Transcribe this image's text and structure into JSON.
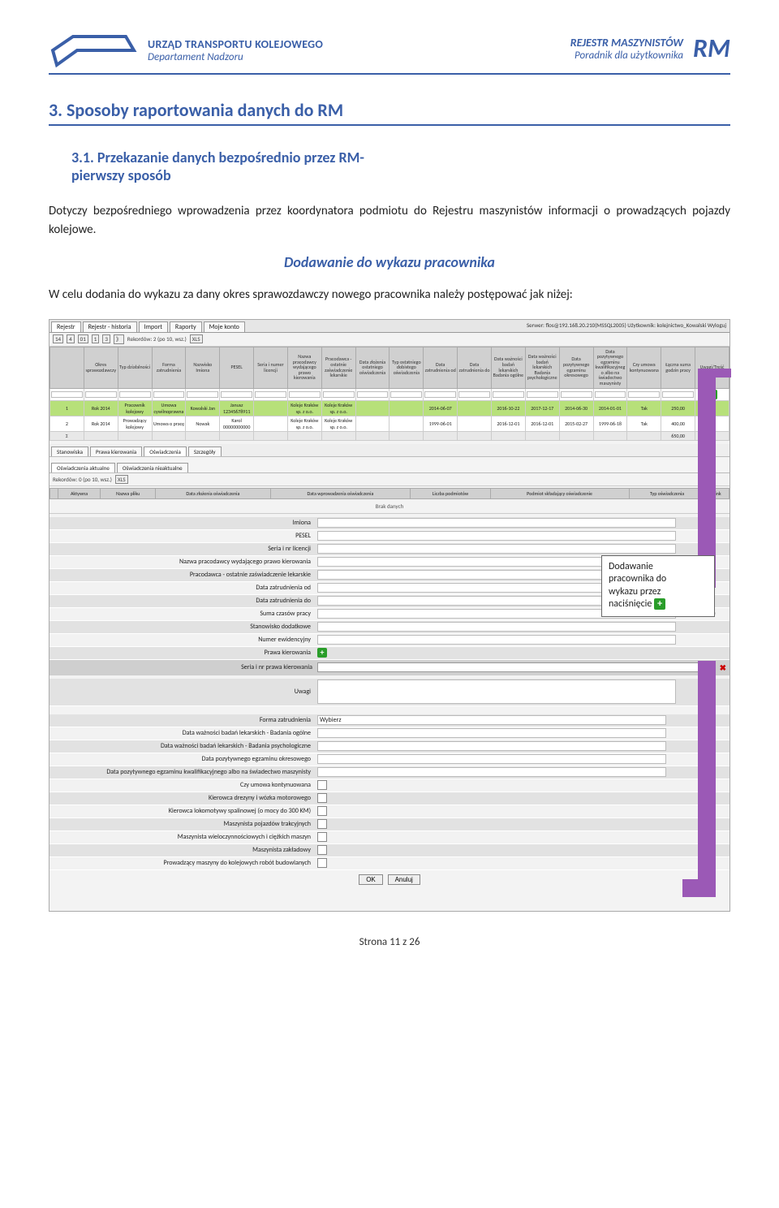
{
  "header": {
    "left_line1": "URZĄD TRANSPORTU KOLEJOWEGO",
    "left_line2": "Departament Nadzoru",
    "right_line1": "REJESTR MASZYNISTÓW",
    "right_line2": "Poradnik dla użytkownika",
    "badge": "RM"
  },
  "h1": "3.  Sposoby raportowania danych do RM",
  "h2_line1": "3.1.   Przekazanie  danych  bezpośrednio  przez  RM-",
  "h2_line2": "pierwszy sposób",
  "p1": "Dotyczy bezpośredniego wprowadzenia przez koordynatora podmiotu do Rejestru maszynistów informacji o prowadzących pojazdy kolejowe.",
  "h3": "Dodawanie do wykazu pracownika",
  "p2": "W celu dodania do wykazu za dany okres sprawozdawczy nowego pracownika należy postępować jak niżej:",
  "callout": {
    "l1": "Dodawanie",
    "l2": "pracownika do",
    "l3": "wykazu przez",
    "l4": "naciśnięcie"
  },
  "ss": {
    "tabs": [
      "Rejestr",
      "Rejestr - historia",
      "Import",
      "Raporty",
      "Moje konto"
    ],
    "server": "Serwer: flos@192.168.20.210(MSSQL2005) Użytkownik: kolejnictwo_Kowalski  Wyloguj",
    "toolbar_text": "Rekordów: 2 (po 10, wsz.)",
    "nav": [
      "14",
      "4",
      "01",
      "1",
      "3",
      "》",
      "XLS"
    ],
    "headers": [
      "",
      "Okres sprawozdawczy",
      "Typ działalności",
      "Forma zatrudnienia",
      "Nazwisko Imiona",
      "PESEL",
      "Seria i numer licencji",
      "Nazwa pracodawcy wydającego prawo kierowania",
      "Pracodawca - ostatnie zaświadczenie lekarskie",
      "Data złożenia ostatniego oświadczenia",
      "Typ ostatniego dobistego oświadczenia",
      "Data zatrudnienia od",
      "Data zatrudnienia do",
      "Data ważności badań lekarskich Badania ogólne",
      "Data ważności badań lekarskich Badania psychologiczne",
      "Data pozytywnego egzaminu okresowego",
      "Data pozytywnego egzaminu kwalifikacyjnego albo na świadectwo maszynisty",
      "Czy umowa kontynuowana",
      "Łączna suma godzin pracy",
      "Uwagi/Treść"
    ],
    "row1": [
      "1",
      "Rok 2014",
      "Pracownik kolejowy",
      "Umowa cywilnoprawna",
      "Kowalski Jan",
      "Janusz 12345678911",
      "",
      "Koleje Kraków sp. z o.o.",
      "Koleje Kraków sp. z o.o.",
      "",
      "",
      "2014-06-07",
      "",
      "2016-10-22",
      "2017-12-17",
      "2014-06-30",
      "2014-01-01",
      "Tak",
      "250,00",
      ""
    ],
    "row2": [
      "2",
      "Rok 2014",
      "Prowadzący kolejowy",
      "Umowa o pracę",
      "Nowak",
      "Karol 00000000000",
      "",
      "Koleje Kraków sp. z o.o.",
      "Koleje Kraków sp. z o.o.",
      "",
      "",
      "1999-06-01",
      "",
      "2016-12-01",
      "2016-12-01",
      "2015-02-27",
      "1999-06-18",
      "Tak",
      "400,00",
      ""
    ],
    "row3_sum": "650,00",
    "subtabs": [
      "Stanowiska",
      "Prawa kierowania",
      "Oświadczenia",
      "Szczegóły"
    ],
    "decl_tab1": "Oświadczenia aktualne",
    "decl_tab2": "Oświadczenia nieaktualne",
    "decl_toolbar": "Rekordów: 0 (po 10, wsz.)",
    "decl_headers": [
      "",
      "Aktywna",
      "Nazwa pliku",
      "Data złożenia oświadczenia",
      "Data wprowadzenia oświadczenia",
      "Liczba podmiotów",
      "Podmiot składający oświadczenie",
      "Typ oświadczenia",
      "Link"
    ],
    "brak": "Brak danych",
    "form": [
      {
        "label": "Imiona",
        "type": "text",
        "star": ""
      },
      {
        "label": "PESEL",
        "type": "text",
        "star": ""
      },
      {
        "label": "Seria i nr licencji",
        "type": "text",
        "star": ""
      },
      {
        "label": "Nazwa pracodawcy wydającego prawo kierowania",
        "type": "text",
        "star": ""
      },
      {
        "label": "Pracodawca - ostatnie zaświadczenie lekarskie",
        "type": "text",
        "star": ""
      },
      {
        "label": "Data zatrudnienia od",
        "type": "text",
        "star": ""
      },
      {
        "label": "Data zatrudnienia do",
        "type": "text",
        "star": ""
      },
      {
        "label": "Suma czasów pracy",
        "type": "text",
        "star": "(*)"
      },
      {
        "label": "Stanowisko dodatkowe",
        "type": "text",
        "star": ""
      },
      {
        "label": "Numer ewidencyjny",
        "type": "text",
        "star": ""
      },
      {
        "label": "Prawa kierowania",
        "type": "add",
        "star": ""
      }
    ],
    "inline_label": "Seria i nr prawa kierowania",
    "form2": [
      {
        "label": "Uwagi",
        "type": "textarea",
        "star": ""
      }
    ],
    "form3": [
      {
        "label": "Forma zatrudnienia",
        "type": "select",
        "value": "Wybierz",
        "star": "(*)"
      },
      {
        "label": "Data ważności badań lekarskich - Badania ogólne",
        "type": "date",
        "star": ""
      },
      {
        "label": "Data ważności badań lekarskich - Badania psychologiczne",
        "type": "date",
        "star": ""
      },
      {
        "label": "Data pozytywnego egzaminu okresowego",
        "type": "date",
        "star": ""
      },
      {
        "label": "Data pozytywnego egzaminu kwalifikacyjnego albo na świadectwo maszynisty",
        "type": "date",
        "star": ""
      },
      {
        "label": "Czy umowa kontynuowana",
        "type": "check",
        "star": ""
      },
      {
        "label": "Kierowca drezyny i wózka motorowego",
        "type": "check",
        "star": "(*)"
      },
      {
        "label": "Kierowca lokomotywy spalinowej (o mocy do 300 KM)",
        "type": "check",
        "star": "(*)"
      },
      {
        "label": "Maszynista pojazdów trakcyjnych",
        "type": "check",
        "star": "(*)"
      },
      {
        "label": "Maszynista wieloczynnościowych i ciężkich maszyn",
        "type": "check",
        "star": "(*)"
      },
      {
        "label": "Maszynista zakładowy",
        "type": "check",
        "star": "(*)"
      },
      {
        "label": "Prowadzący maszyny do kolejowych robót budowlanych",
        "type": "check",
        "star": "(*)"
      }
    ],
    "btn_ok": "OK",
    "btn_cancel": "Anuluj"
  },
  "footer": "Strona 11 z 26"
}
